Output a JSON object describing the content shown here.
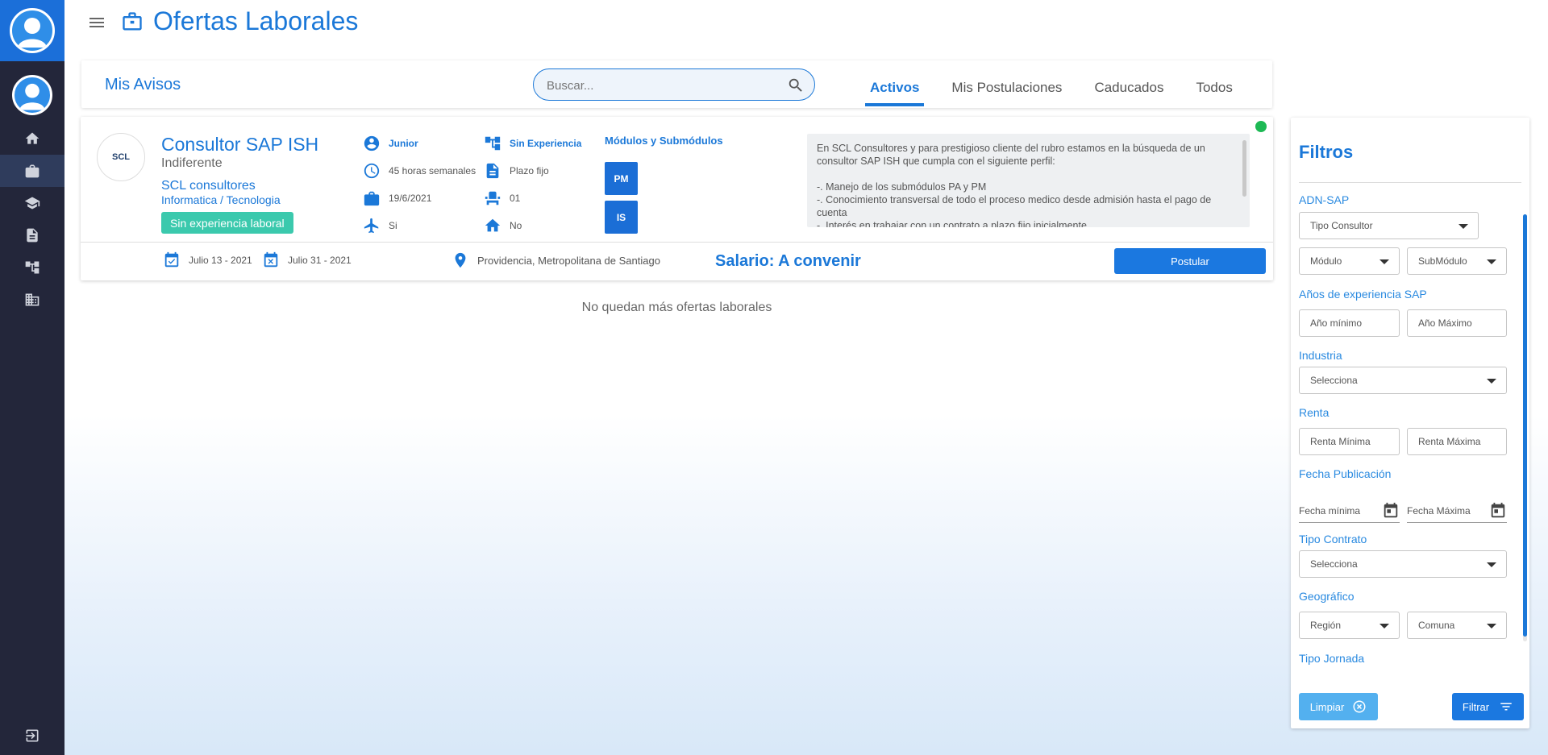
{
  "header": {
    "title": "Ofertas Laborales"
  },
  "topbar": {
    "section_title": "Mis Avisos",
    "search_placeholder": "Buscar...",
    "tabs": [
      {
        "label": "Activos",
        "active": true
      },
      {
        "label": "Mis Postulaciones",
        "active": false
      },
      {
        "label": "Caducados",
        "active": false
      },
      {
        "label": "Todos",
        "active": false
      }
    ]
  },
  "job": {
    "logo_text": "SCL",
    "title": "Consultor SAP ISH",
    "level": "Indiferente",
    "company": "SCL consultores",
    "industry": "Informatica / Tecnologia",
    "experience_badge": "Sin experiencia laboral",
    "attributes": {
      "seniority": "Junior",
      "hours": "45 horas semanales",
      "date": "19/6/2021",
      "travel": "Si",
      "experience": "Sin Experiencia",
      "contract": "Plazo fijo",
      "vacancies": "01",
      "remote": "No"
    },
    "modules_title": "Módulos y Submódulos",
    "modules": [
      "PM",
      "IS"
    ],
    "description_lines": [
      "En SCL Consultores y para prestigioso cliente del rubro estamos en la búsqueda de un consultor SAP ISH que cumpla con el siguiente perfil:",
      "",
      "-. Manejo de los submódulos PA y PM",
      "-. Conocimiento transversal de todo el proceso medico desde admisión hasta el pago de cuenta",
      "-. Interés en trabajar con un contrato a plazo fijo inicialmente"
    ],
    "publish_date": "Julio 13 - 2021",
    "close_date": "Julio 31 - 2021",
    "location": "Providencia, Metropolitana de Santiago",
    "salary": "Salario: A convenir",
    "apply_label": "Postular",
    "status_color": "#1db954"
  },
  "no_more_text": "No quedan más ofertas laborales",
  "filters": {
    "title": "Filtros",
    "adn_label": "ADN-SAP",
    "tipo_consultor": "Tipo Consultor",
    "modulo": "Módulo",
    "submodulo": "SubMódulo",
    "experiencia_label": "Años de experiencia SAP",
    "ano_minimo": "Año mínimo",
    "ano_maximo": "Año Máximo",
    "industria_label": "Industria",
    "industria_select": "Selecciona",
    "renta_label": "Renta",
    "renta_minima": "Renta Mínima",
    "renta_maxima": "Renta Máxima",
    "fecha_label": "Fecha Publicación",
    "fecha_minima": "Fecha mínima",
    "fecha_maxima": "Fecha Máxima",
    "contrato_label": "Tipo Contrato",
    "contrato_select": "Selecciona",
    "geo_label": "Geográfico",
    "region": "Región",
    "comuna": "Comuna",
    "jornada_label": "Tipo Jornada",
    "clear_label": "Limpiar",
    "filter_label": "Filtrar"
  },
  "colors": {
    "accent": "#1b78d8",
    "sidebar": "#23263a",
    "badge": "#3bc9ad"
  }
}
